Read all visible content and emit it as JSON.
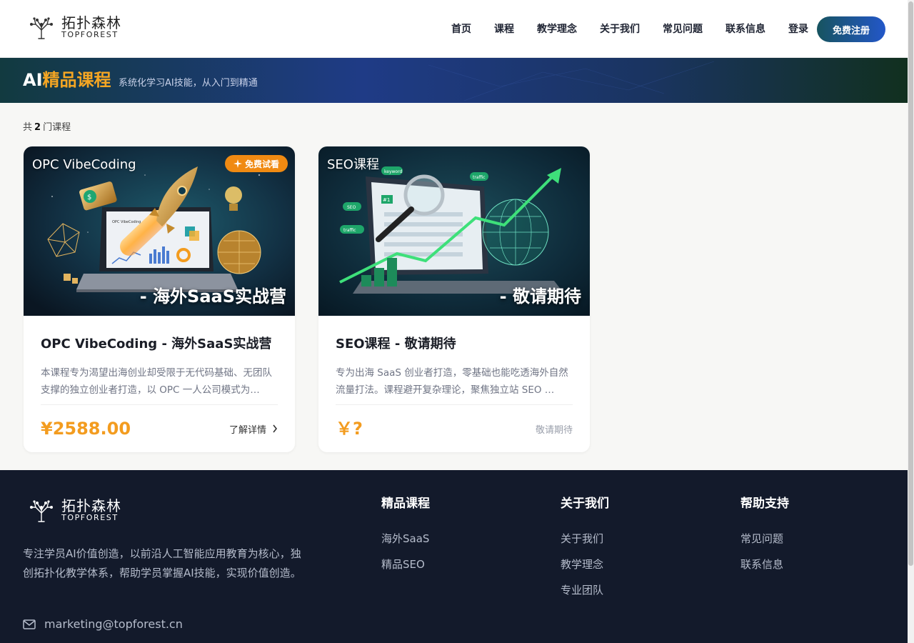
{
  "brand": {
    "name_cn": "拓扑森林",
    "name_en": "TOPFOREST"
  },
  "nav": {
    "items": [
      "首页",
      "课程",
      "教学理念",
      "关于我们",
      "常见问题",
      "联系信息"
    ],
    "login": "登录",
    "register": "免费注册"
  },
  "banner": {
    "title_prefix": "AI",
    "title_accent": "精品课程",
    "subtitle": "系统化学习AI技能，从入门到精通"
  },
  "count": {
    "prefix": "共",
    "number": "2",
    "suffix": "门课程"
  },
  "courses": [
    {
      "thumb_tag": "OPC VibeCoding",
      "badge": "免费试看",
      "overlay": "- 海外SaaS实战营",
      "title": "OPC VibeCoding - 海外SaaS实战营",
      "desc": "本课程专为渴望出海创业却受限于无代码基础、无团队支撑的独立创业者打造，以 OPC 一人公司模式为…",
      "price": "¥2588.00",
      "action": "了解详情"
    },
    {
      "thumb_tag": "SEO课程",
      "overlay": "- 敬请期待",
      "title": "SEO课程 - 敬请期待",
      "desc": "专为出海 SaaS 创业者打造，零基础也能吃透海外自然流量打法。课程避开复杂理论，聚焦独立站 SEO …",
      "price": "￥?",
      "action": "敬请期待"
    }
  ],
  "thumb_labels": {
    "keyword": "keyword",
    "seo": "SEO",
    "traffic": "traffic",
    "rank": "#1",
    "opc_screen": "OPC VibeCoding"
  },
  "footer": {
    "about": "专注学员AI价值创造，以前沿人工智能应用教育为核心，独创拓扑化教学体系，帮助学员掌握AI技能，实现价值创造。",
    "email": "marketing@topforest.cn",
    "columns": [
      {
        "title": "精品课程",
        "links": [
          "海外SaaS",
          "精品SEO"
        ]
      },
      {
        "title": "关于我们",
        "links": [
          "关于我们",
          "教学理念",
          "专业团队"
        ]
      },
      {
        "title": "帮助支持",
        "links": [
          "常见问题",
          "联系信息"
        ]
      }
    ]
  },
  "colors": {
    "accent": "#f39c1f",
    "badge": "#f08a12",
    "footer_bg": "#131a2b",
    "register_from": "#17545f",
    "register_to": "#2357c9"
  },
  "icons": {
    "logo": "tree-network-icon",
    "badge": "sparkle-icon",
    "more": "chevron-right-icon",
    "mail": "mail-icon"
  }
}
